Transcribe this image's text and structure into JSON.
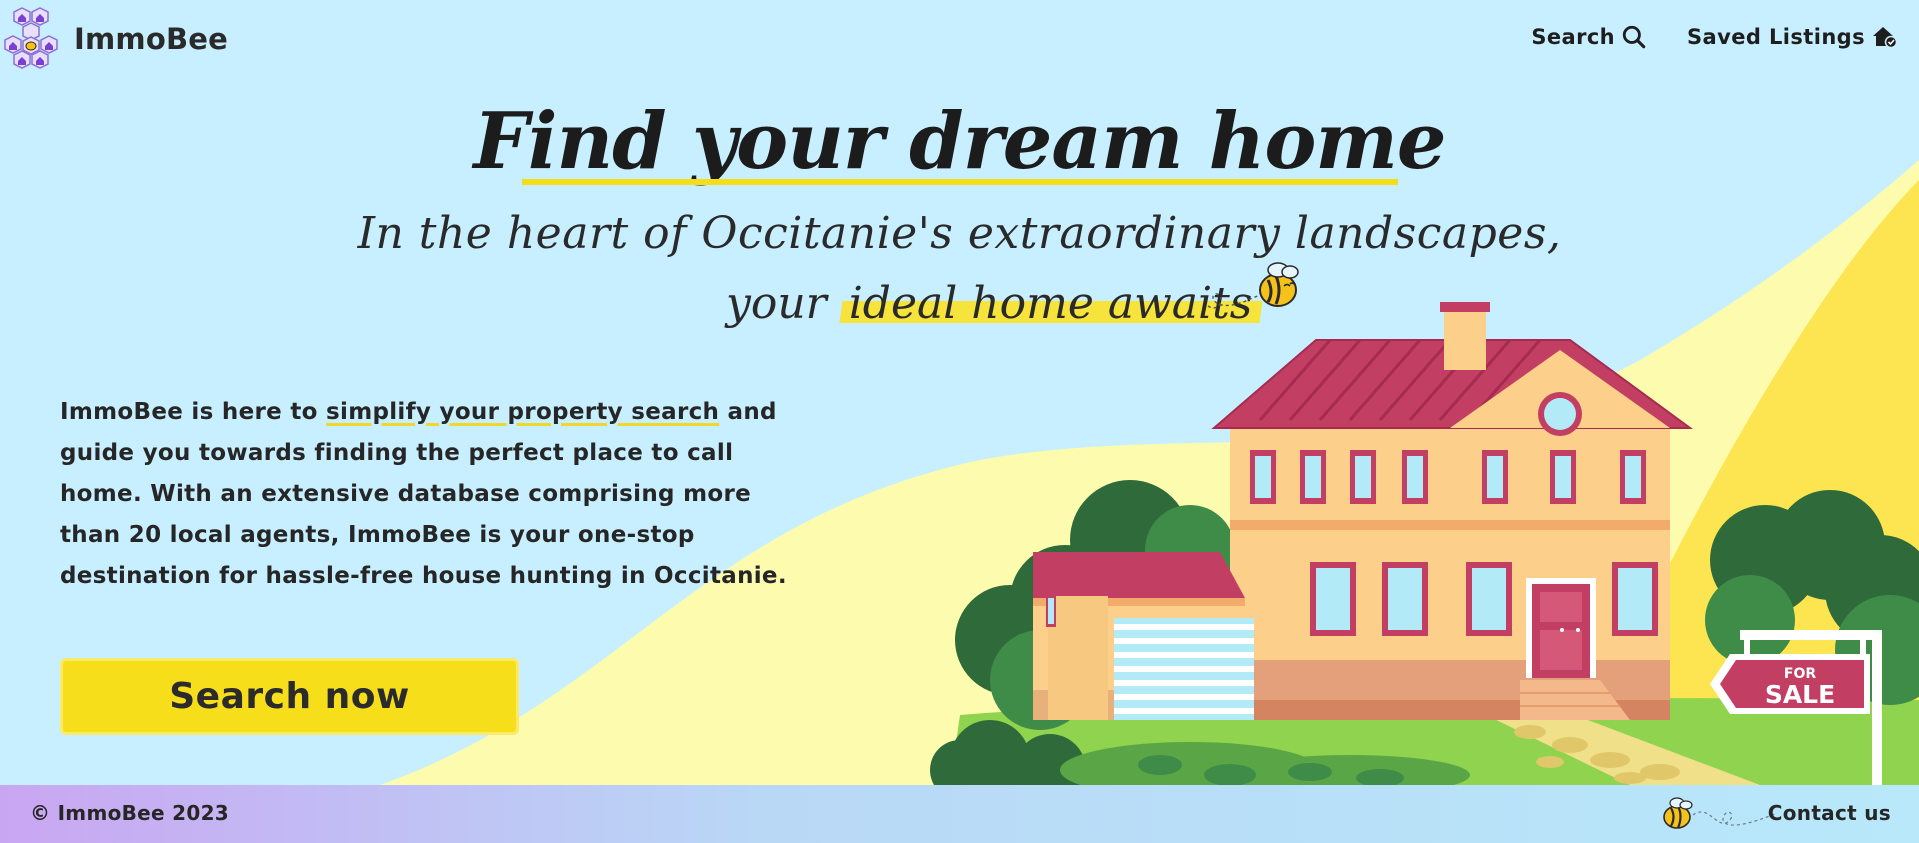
{
  "brand": {
    "name": "ImmoBee"
  },
  "nav": {
    "search_label": "Search",
    "saved_label": "Saved Listings"
  },
  "hero": {
    "title": "Find your dream home",
    "subtitle_line1": "In the heart of Occitanie's extraordinary landscapes,",
    "subtitle_line2_prefix": "your",
    "subtitle_line2_highlight": "ideal home awaits"
  },
  "intro": {
    "part1": "ImmoBee is here to ",
    "link": "simplify your property search",
    "part2": " and guide you towards finding the perfect place to call home. With an extensive database comprising more than 20 local agents, ImmoBee is your one-stop destination for hassle-free house hunting in Occitanie."
  },
  "cta": {
    "label": "Search now"
  },
  "illustration": {
    "sign_top": "FOR",
    "sign_bottom": "SALE"
  },
  "footer": {
    "copyright": "© ImmoBee 2023",
    "contact_label": "Contact us"
  },
  "colors": {
    "sky": "#c7efff",
    "accent_yellow": "#f7de1a",
    "roof": "#c23f63",
    "house_wall": "#fcd08a",
    "grass": "#8fd34e"
  },
  "icons": [
    "hexagon-house-logo-icon",
    "search-icon",
    "house-check-icon",
    "bee-icon"
  ]
}
